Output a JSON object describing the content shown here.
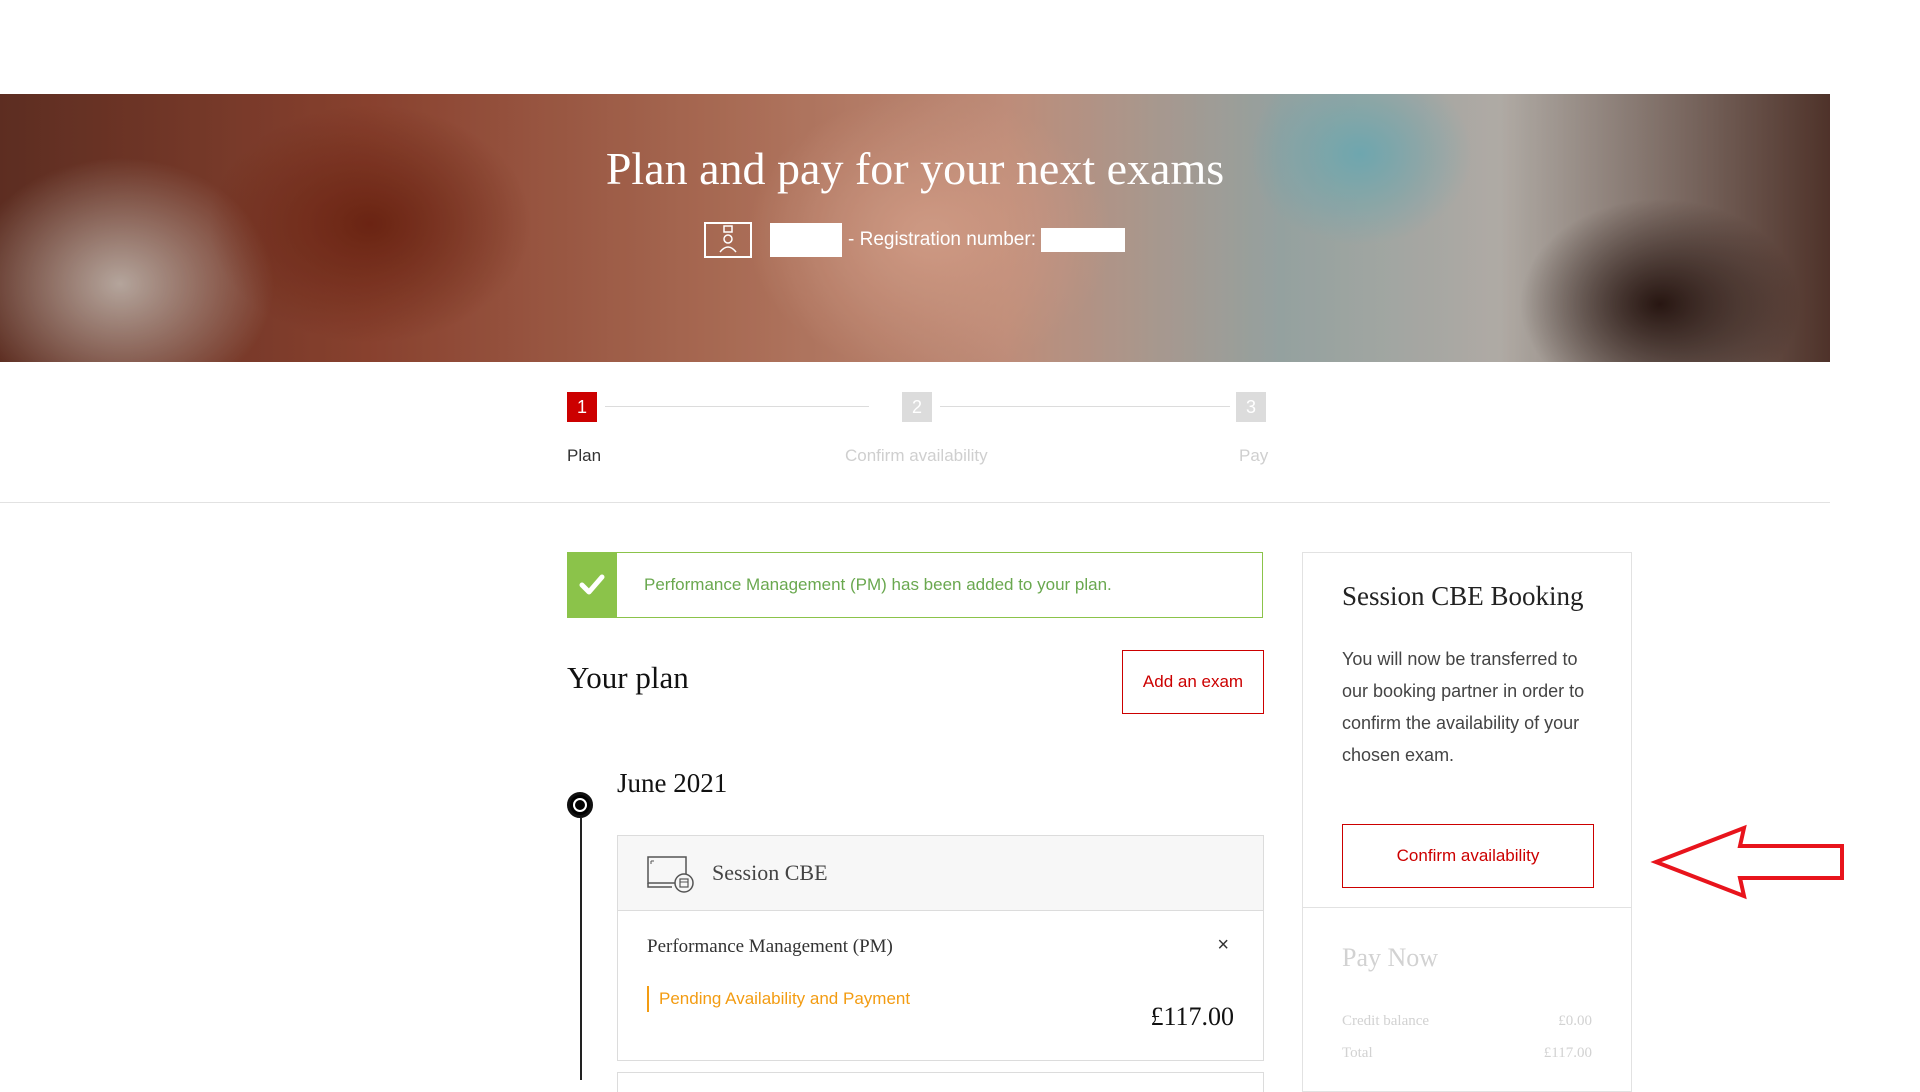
{
  "hero": {
    "title": "Plan and pay for your next exams",
    "registration_label": "- Registration number:"
  },
  "stepper": {
    "steps": [
      {
        "number": "1",
        "label": "Plan",
        "state": "active"
      },
      {
        "number": "2",
        "label": "Confirm availability",
        "state": "inactive"
      },
      {
        "number": "3",
        "label": "Pay",
        "state": "inactive"
      }
    ]
  },
  "notification": {
    "message": "Performance Management (PM) has been added to your plan."
  },
  "plan": {
    "heading": "Your plan",
    "add_exam_label": "Add an exam",
    "month": "June 2021",
    "session_title": "Session CBE",
    "exam_name": "Performance Management (PM)",
    "remove_symbol": "×",
    "status": "Pending Availability and Payment",
    "price": "£117.00"
  },
  "panel": {
    "title": "Session CBE Booking",
    "text": "You will now be transferred to our booking partner in order to confirm the availability of your chosen exam.",
    "confirm_label": "Confirm availability",
    "pay_title": "Pay Now",
    "credit_label": "Credit balance",
    "credit_value": "£0.00",
    "total_label": "Total",
    "total_value": "£117.00"
  },
  "colors": {
    "accent": "#cc0000",
    "success": "#8bc34a",
    "pending": "#f39c12",
    "inactive": "#dcdcdc"
  }
}
